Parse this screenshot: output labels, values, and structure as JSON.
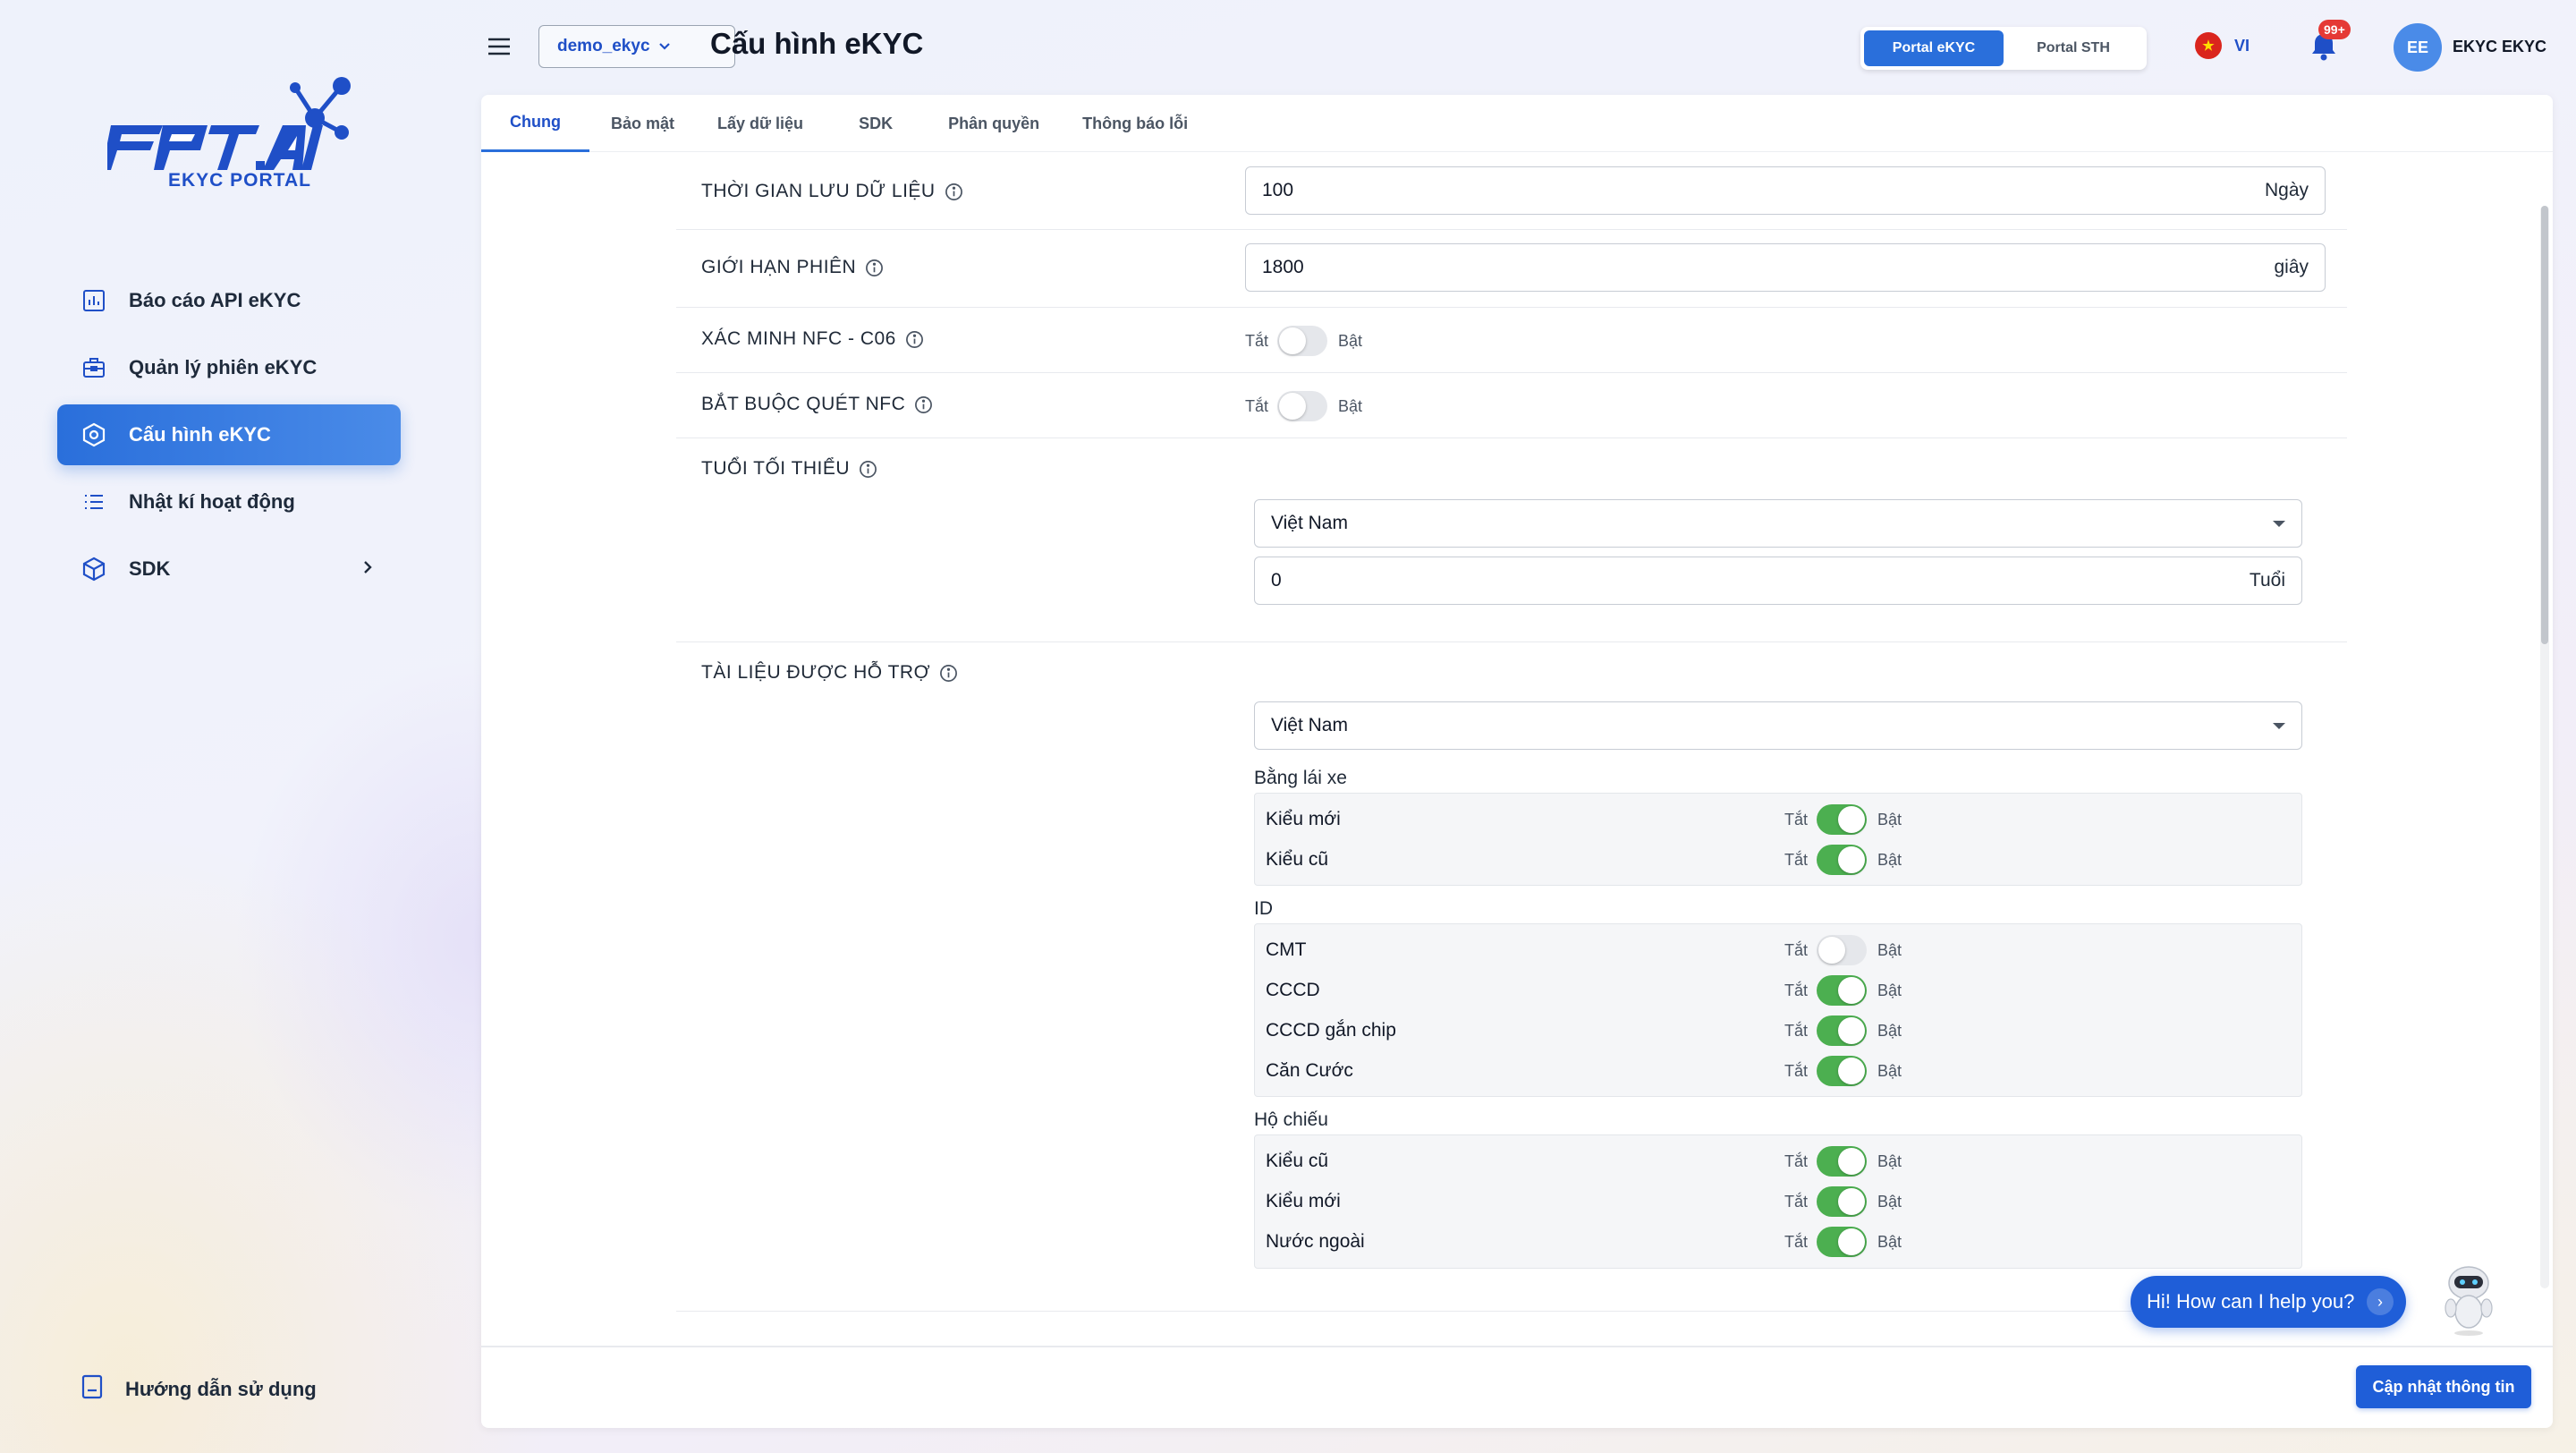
{
  "brand": {
    "logo_text": "FPT.AI",
    "subtitle": "EKYC PORTAL"
  },
  "sidebar": {
    "items": [
      {
        "label": "Báo cáo API eKYC",
        "icon": "report-chart-icon",
        "active": false
      },
      {
        "label": "Quản lý phiên eKYC",
        "icon": "briefcase-icon",
        "active": false
      },
      {
        "label": "Cấu hình eKYC",
        "icon": "settings-hex-icon",
        "active": true
      },
      {
        "label": "Nhật kí hoạt động",
        "icon": "list-icon",
        "active": false
      },
      {
        "label": "SDK",
        "icon": "cube-icon",
        "active": false,
        "has_submenu": true
      }
    ],
    "guide_label": "Hướng dẫn sử dụng"
  },
  "header": {
    "project": "demo_ekyc",
    "title": "Cấu hình eKYC",
    "portal_switch": {
      "active": "Portal eKYC",
      "inactive": "Portal STH"
    },
    "language": "VI",
    "notification_badge": "99+",
    "user_initials": "EE",
    "user_name": "EKYC EKYC"
  },
  "tabs": [
    "Chung",
    "Bảo mật",
    "Lấy dữ liệu",
    "SDK",
    "Phân quyền",
    "Thông báo lỗi"
  ],
  "active_tab": "Chung",
  "toggle_labels": {
    "off": "Tắt",
    "on": "Bật"
  },
  "settings": {
    "retention": {
      "label": "THỜI GIAN LƯU DỮ LIỆU",
      "value": "100",
      "unit": "Ngày"
    },
    "session_limit": {
      "label": "GIỚI HẠN PHIÊN",
      "value": "1800",
      "unit": "giây"
    },
    "nfc_c06": {
      "label": "XÁC MINH NFC - C06",
      "enabled": false
    },
    "nfc_required": {
      "label": "BẮT BUỘC QUÉT NFC",
      "enabled": false
    },
    "min_age": {
      "label": "TUỔI TỐI THIỂU",
      "country": "Việt Nam",
      "value": "0",
      "unit": "Tuổi"
    },
    "documents": {
      "label": "TÀI LIỆU ĐƯỢC HỖ TRỢ",
      "country": "Việt Nam",
      "groups": [
        {
          "title": "Bằng lái xe",
          "items": [
            {
              "label": "Kiểu mới",
              "enabled": true
            },
            {
              "label": "Kiểu cũ",
              "enabled": true
            }
          ]
        },
        {
          "title": "ID",
          "items": [
            {
              "label": "CMT",
              "enabled": false
            },
            {
              "label": "CCCD",
              "enabled": true
            },
            {
              "label": "CCCD gắn chip",
              "enabled": true
            },
            {
              "label": "Căn Cước",
              "enabled": true
            }
          ]
        },
        {
          "title": "Hộ chiếu",
          "items": [
            {
              "label": "Kiểu cũ",
              "enabled": true
            },
            {
              "label": "Kiểu mới",
              "enabled": true
            },
            {
              "label": "Nước ngoài",
              "enabled": true
            }
          ]
        }
      ]
    }
  },
  "save_button": "Cập nhật thông tin",
  "chat": {
    "greeting": "Hi! How can I help you?"
  },
  "colors": {
    "primary": "#1f5ed8",
    "toggle_on": "#4caf50",
    "brand_blue": "#1f4fc7"
  }
}
